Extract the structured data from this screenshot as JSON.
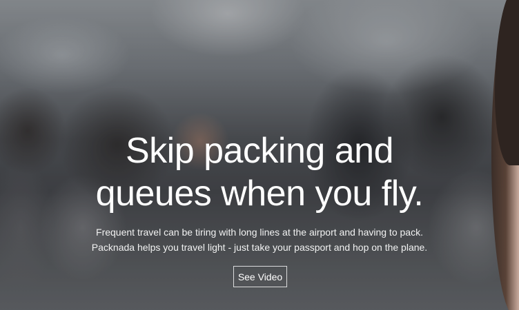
{
  "hero": {
    "headline_line1": "Skip packing and",
    "headline_line2": "queues when you fly.",
    "subtext_line1": "Frequent travel can be tiring with long lines at the airport and having to pack.",
    "subtext_line2": "Packnada helps you travel light - just take your passport and hop on the plane.",
    "button_label": "See Video"
  }
}
